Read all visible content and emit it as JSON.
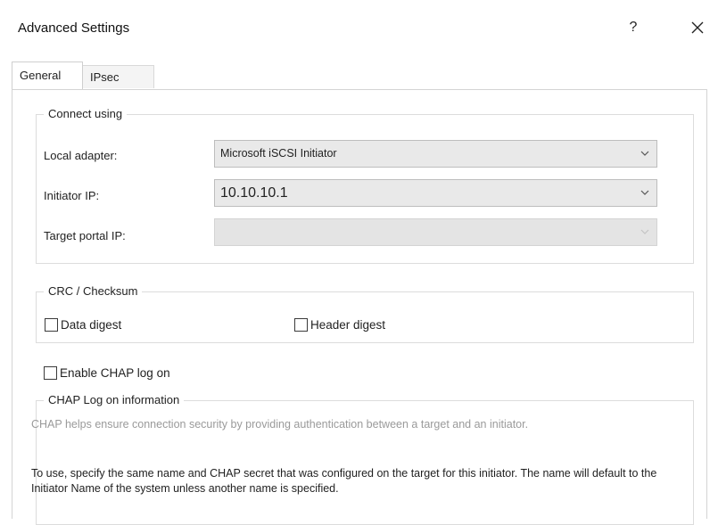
{
  "window": {
    "title": "Advanced Settings",
    "help_label": "?",
    "close_icon": "close-icon"
  },
  "tabs": [
    {
      "label": "General",
      "active": true
    },
    {
      "label": "IPsec",
      "active": false
    }
  ],
  "connect_using": {
    "legend": "Connect using",
    "local_adapter": {
      "label": "Local adapter:",
      "value": "Microsoft iSCSI Initiator"
    },
    "initiator_ip": {
      "label": "Initiator IP:",
      "value": "10.10.10.1"
    },
    "target_portal_ip": {
      "label": "Target portal IP:",
      "value": "",
      "disabled": true
    }
  },
  "crc": {
    "legend": "CRC / Checksum",
    "data_digest": {
      "label": "Data digest",
      "checked": false
    },
    "header_digest": {
      "label": "Header digest",
      "checked": false
    }
  },
  "chap": {
    "enable_label": "Enable CHAP log on",
    "enable_checked": false,
    "legend": "CHAP Log on information",
    "description": "CHAP helps ensure connection security by providing authentication between a target and an initiator.",
    "instructions": "To use, specify the same name and CHAP secret that was configured on the target for this initiator.  The name will default to the Initiator Name of the system unless another name is specified."
  }
}
